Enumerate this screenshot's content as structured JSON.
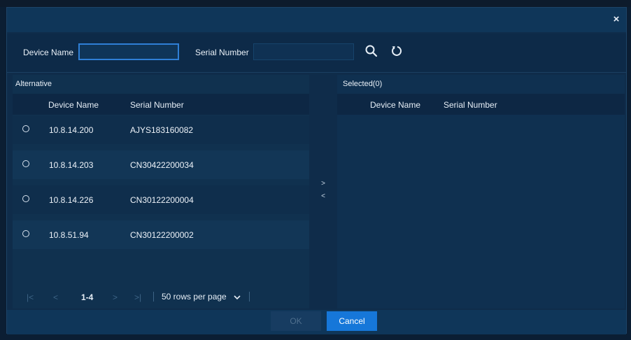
{
  "dialog": {
    "close_label": "×"
  },
  "filter": {
    "device_name_label": "Device Name",
    "device_name_value": "",
    "serial_number_label": "Serial Number",
    "serial_number_value": "",
    "search_icon": "search-icon",
    "reset_icon": "refresh-icon"
  },
  "alternative": {
    "title": "Alternative",
    "columns": [
      "Device Name",
      "Serial Number"
    ],
    "rows": [
      {
        "device": "10.8.14.200",
        "serial": "AJYS183160082"
      },
      {
        "device": "10.8.14.203",
        "serial": "CN30422200034"
      },
      {
        "device": "10.8.14.226",
        "serial": "CN30122200004"
      },
      {
        "device": "10.8.51.94",
        "serial": "CN30122200002"
      }
    ],
    "pager": {
      "first": "|<",
      "prev": "<",
      "range": "1-4",
      "next": ">",
      "last": ">|",
      "rows_per_page": "50 rows per page"
    }
  },
  "transfer": {
    "add": ">",
    "remove": "<"
  },
  "selected": {
    "title": "Selected(0)",
    "columns": [
      "Device Name",
      "Serial Number"
    ]
  },
  "footer": {
    "ok_label": "OK",
    "cancel_label": "Cancel"
  },
  "colors": {
    "background": "#0f2c4a",
    "accent": "#1677d9",
    "header": "#0f3659"
  }
}
